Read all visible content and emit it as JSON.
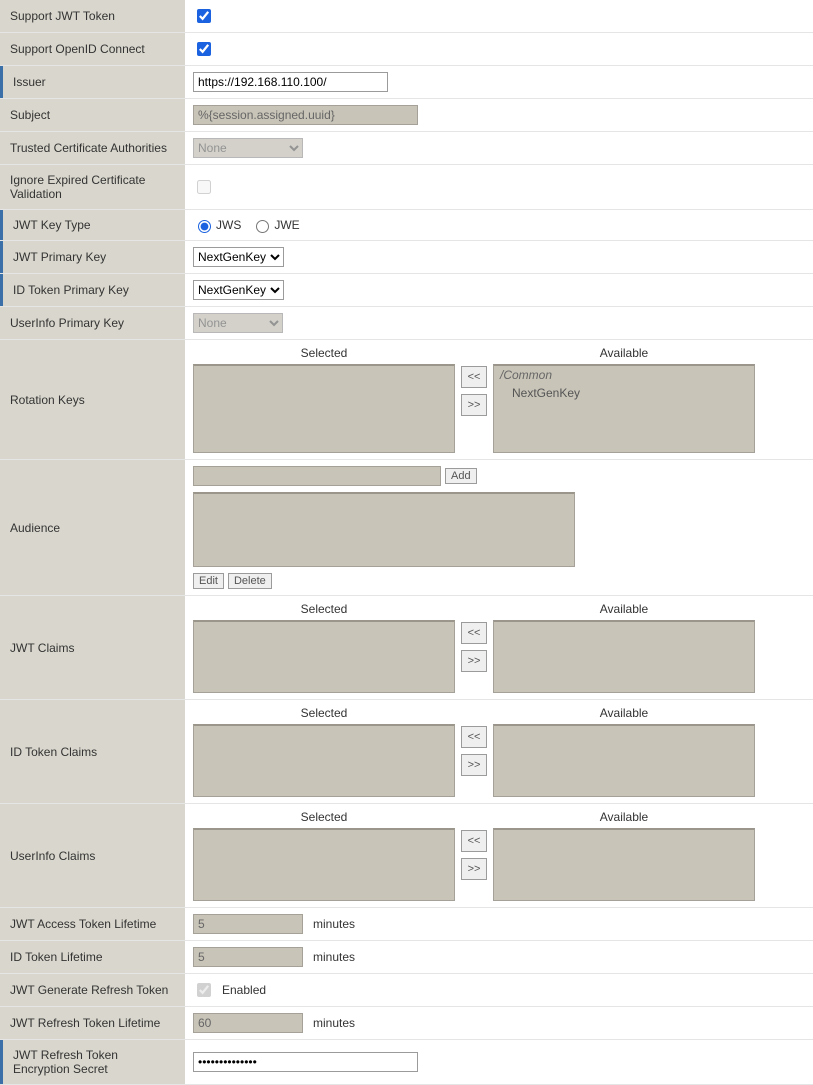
{
  "rows": {
    "support_jwt": {
      "label": "Support JWT Token",
      "checked": true
    },
    "support_oidc": {
      "label": "Support OpenID Connect",
      "checked": true
    },
    "issuer": {
      "label": "Issuer",
      "value": "https://192.168.110.100/"
    },
    "subject": {
      "label": "Subject",
      "value": "%{session.assigned.uuid}"
    },
    "trusted_ca": {
      "label": "Trusted Certificate Authorities",
      "options": [
        "None"
      ],
      "selected": "None"
    },
    "ignore_expired": {
      "label": "Ignore Expired Certificate Validation",
      "checked": false
    },
    "jwt_key_type": {
      "label": "JWT Key Type",
      "opt1": "JWS",
      "opt2": "JWE",
      "selected": "JWS"
    },
    "jwt_primary_key": {
      "label": "JWT Primary Key",
      "options": [
        "NextGenKey"
      ],
      "selected": "NextGenKey"
    },
    "id_token_primary_key": {
      "label": "ID Token Primary Key",
      "options": [
        "NextGenKey"
      ],
      "selected": "NextGenKey"
    },
    "userinfo_primary_key": {
      "label": "UserInfo Primary Key",
      "options": [
        "None"
      ],
      "selected": "None"
    },
    "rotation_keys": {
      "label": "Rotation Keys",
      "selected_header": "Selected",
      "available_header": "Available",
      "available_group": "/Common",
      "available_items": [
        "NextGenKey"
      ]
    },
    "audience": {
      "label": "Audience",
      "add": "Add",
      "edit": "Edit",
      "delete": "Delete"
    },
    "jwt_claims": {
      "label": "JWT Claims",
      "selected_header": "Selected",
      "available_header": "Available"
    },
    "id_token_claims": {
      "label": "ID Token Claims",
      "selected_header": "Selected",
      "available_header": "Available"
    },
    "userinfo_claims": {
      "label": "UserInfo Claims",
      "selected_header": "Selected",
      "available_header": "Available"
    },
    "jwt_access_lifetime": {
      "label": "JWT Access Token Lifetime",
      "value": "5",
      "unit": "minutes"
    },
    "id_token_lifetime": {
      "label": "ID Token Lifetime",
      "value": "5",
      "unit": "minutes"
    },
    "jwt_gen_refresh": {
      "label": "JWT Generate Refresh Token",
      "text": "Enabled",
      "checked": true
    },
    "jwt_refresh_lifetime": {
      "label": "JWT Refresh Token Lifetime",
      "value": "60",
      "unit": "minutes"
    },
    "jwt_refresh_secret": {
      "label": "JWT Refresh Token Encryption Secret",
      "value": "••••••••••••••"
    }
  },
  "move": {
    "left": "<<",
    "right": ">>"
  }
}
